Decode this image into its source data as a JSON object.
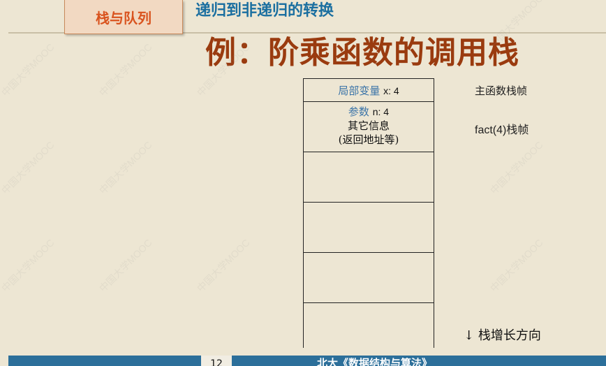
{
  "header": {
    "section_tab": "栈与队列",
    "title": "递归到非递归的转换"
  },
  "slide": {
    "title": "例：阶乘函数的调用栈"
  },
  "stack": {
    "frames": [
      {
        "label": "局部变量",
        "value": "x: 4"
      },
      {
        "label": "参数",
        "value": "n: 4",
        "line2": "其它信息",
        "line3": "(返回地址等)"
      }
    ],
    "labels": {
      "main_frame": "主函数栈帧",
      "fact_frame": "fact(4)栈帧"
    },
    "growth_arrow": "↓",
    "growth_label": "栈增长方向"
  },
  "footer": {
    "page_number": "12",
    "course_title": "北大《数据结构与算法》"
  },
  "watermark": "中国大学MOOC"
}
